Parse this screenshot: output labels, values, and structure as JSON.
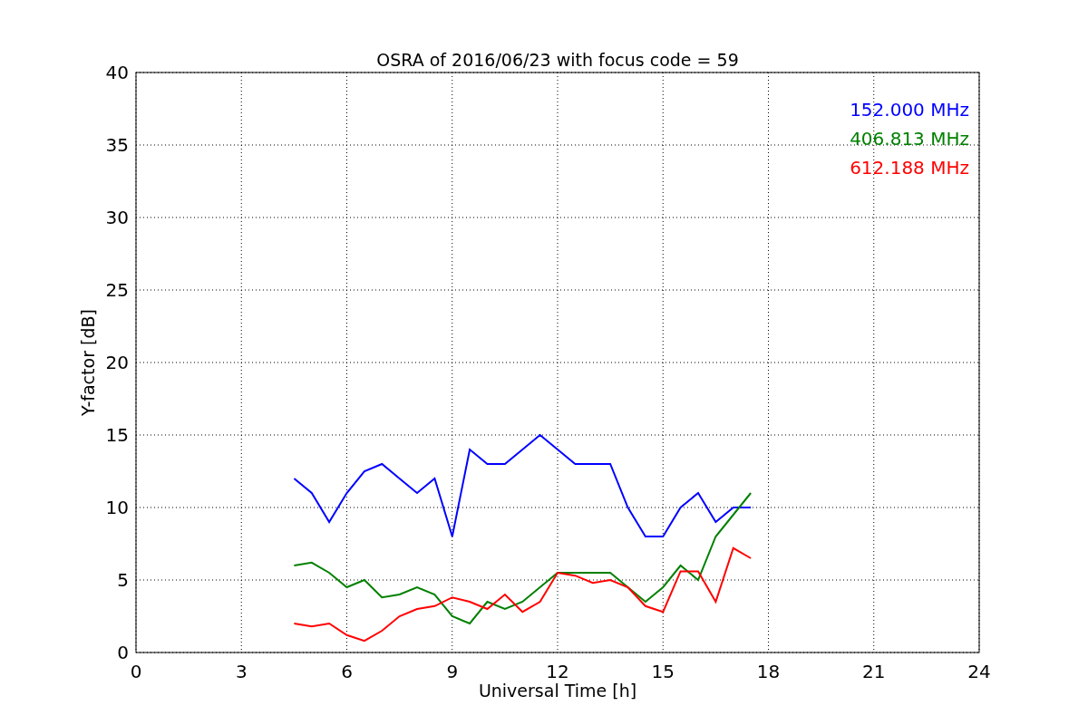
{
  "figure": {
    "chart_data": {
      "type": "line",
      "title": "OSRA of 2016/06/23 with focus code = 59",
      "xlabel": "Universal Time [h]",
      "ylabel": "Y-factor [dB]",
      "x": [
        4.5,
        5,
        5.5,
        6,
        6.5,
        7,
        7.5,
        8,
        8.5,
        9,
        9.5,
        10,
        10.5,
        11,
        11.5,
        12,
        12.5,
        13,
        13.5,
        14,
        14.5,
        15,
        15.5,
        16,
        16.5,
        17,
        17.5
      ],
      "series": [
        {
          "name": "152.000 MHz",
          "color": "#0000ff",
          "values": [
            12,
            11,
            9,
            11,
            12.5,
            13,
            12,
            11,
            12,
            8,
            14,
            13,
            13,
            14,
            15,
            14,
            13,
            13,
            13,
            10,
            8,
            8,
            10,
            11,
            9,
            10,
            10
          ]
        },
        {
          "name": "406.813 MHz",
          "color": "#008000",
          "values": [
            6,
            6.2,
            5.5,
            4.5,
            5,
            3.8,
            4,
            4.5,
            4,
            2.5,
            2,
            3.5,
            3,
            3.5,
            4.5,
            5.5,
            5.5,
            5.5,
            5.5,
            4.5,
            3.5,
            4.5,
            6,
            5,
            8,
            9.5,
            11
          ]
        },
        {
          "name": "612.188 MHz",
          "color": "#ff0000",
          "values": [
            2,
            1.8,
            2,
            1.2,
            0.8,
            1.5,
            2.5,
            3,
            3.2,
            3.8,
            3.5,
            3,
            4,
            2.8,
            3.5,
            5.5,
            5.3,
            4.8,
            5,
            4.5,
            3.2,
            2.8,
            5.6,
            5.6,
            3.5,
            7.2,
            6.5
          ]
        }
      ],
      "xlim": [
        0,
        24
      ],
      "ylim": [
        0,
        40
      ],
      "xticks": [
        0,
        3,
        6,
        9,
        12,
        15,
        18,
        21,
        24
      ],
      "yticks": [
        0,
        5,
        10,
        15,
        20,
        25,
        30,
        35,
        40
      ],
      "grid": true
    }
  }
}
